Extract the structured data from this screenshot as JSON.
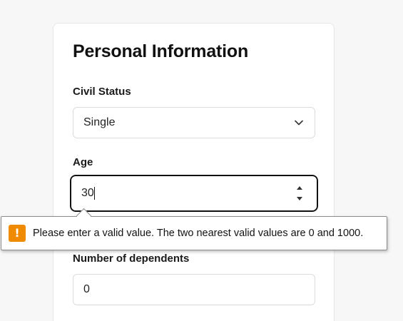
{
  "form": {
    "title": "Personal Information",
    "civil_status": {
      "label": "Civil Status",
      "selected": "Single"
    },
    "age": {
      "label": "Age",
      "value": "30"
    },
    "dependents": {
      "label": "Number of dependents",
      "value": "0"
    }
  },
  "validation": {
    "message": "Please enter a valid value. The two nearest valid values are 0 and 1000.",
    "icon": "warning-icon",
    "icon_color": "#f08a00"
  }
}
